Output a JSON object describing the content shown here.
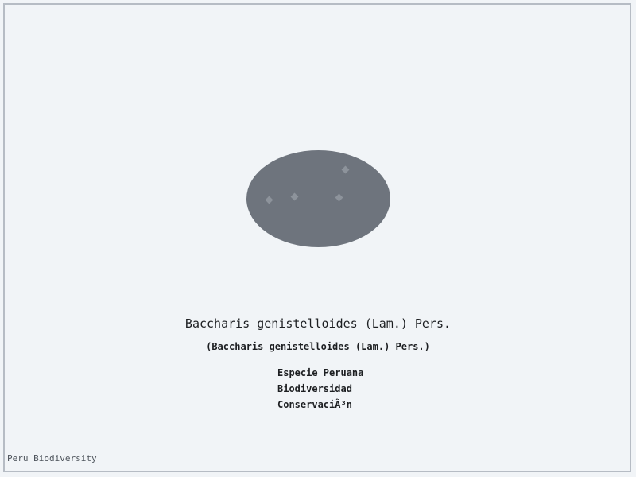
{
  "image": {
    "name": "specimen-image",
    "color": "#6e747d",
    "dot_color": "#8d939b"
  },
  "species": {
    "title": "Baccharis genistelloides (Lam.) Pers.",
    "subtitle": "(Baccharis genistelloides (Lam.) Pers.)"
  },
  "tags": [
    "Especie Peruana",
    "Biodiversidad",
    "ConservaciÃ³n"
  ],
  "footer": {
    "label": "Peru Biodiversity"
  }
}
